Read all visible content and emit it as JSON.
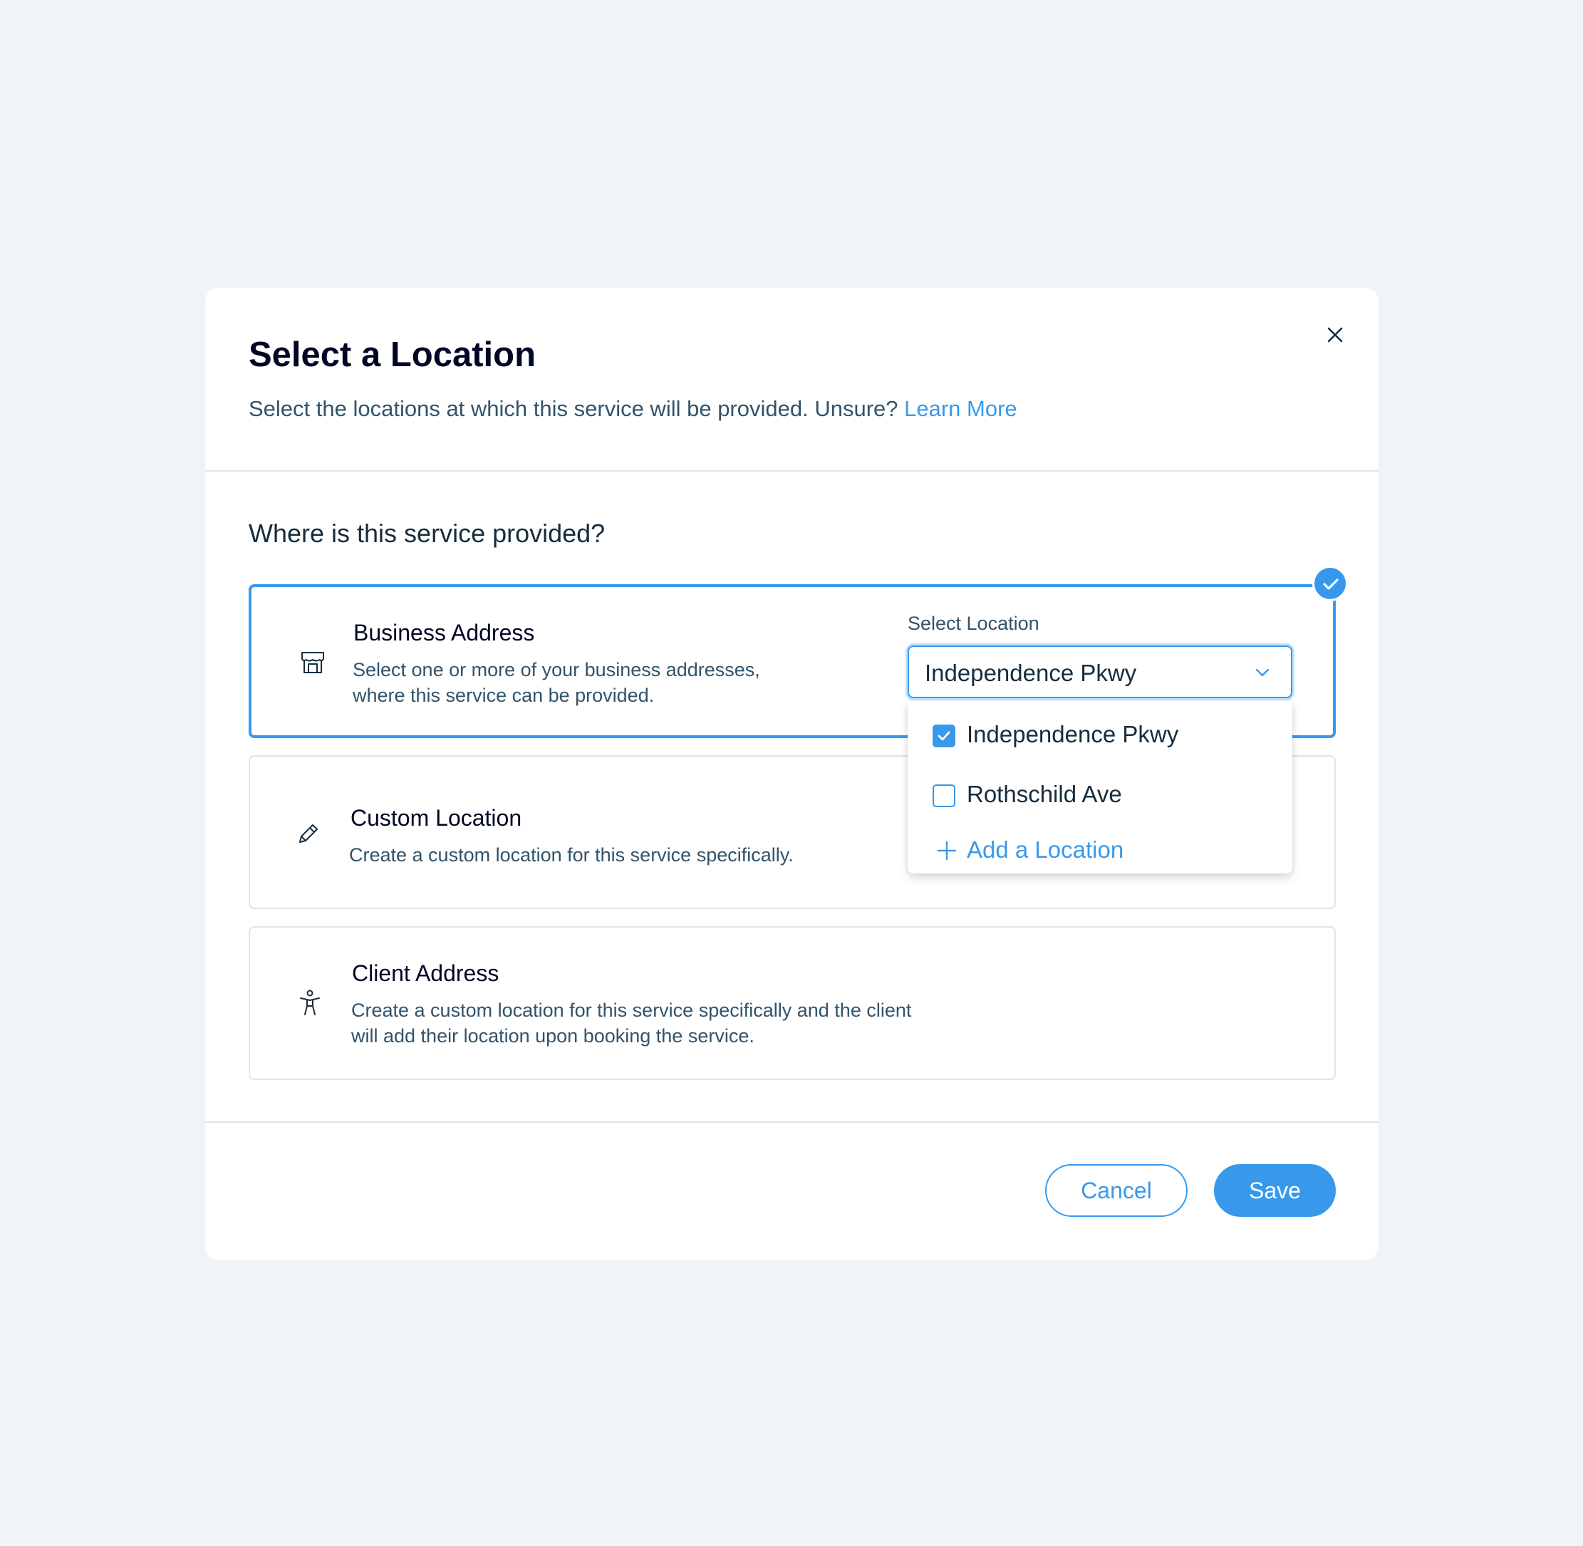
{
  "modal": {
    "title": "Select a Location",
    "subtitle": "Select the locations at which this service will be provided. Unsure?",
    "learn_more": "Learn More",
    "question": "Where is this service provided?"
  },
  "options": [
    {
      "title": "Business Address",
      "description": "Select one or more of your business addresses, where this service can be provided.",
      "icon": "store-icon",
      "selected": true
    },
    {
      "title": "Custom Location",
      "description": "Create a custom location for this service specifically.",
      "icon": "pencil-icon",
      "selected": false
    },
    {
      "title": "Client Address",
      "description": "Create a custom location for this service specifically and the client will add their location upon booking the service.",
      "icon": "person-icon",
      "selected": false
    }
  ],
  "location_select": {
    "label": "Select Location",
    "value": "Independence Pkwy",
    "items": [
      {
        "label": "Independence Pkwy",
        "checked": true
      },
      {
        "label": "Rothschild Ave",
        "checked": false
      }
    ],
    "add_label": "Add a Location"
  },
  "footer": {
    "cancel": "Cancel",
    "save": "Save"
  },
  "colors": {
    "accent": "#3899ec",
    "background": "#f0f4f7",
    "text": "#162d3d",
    "secondary_text": "#32536a"
  }
}
